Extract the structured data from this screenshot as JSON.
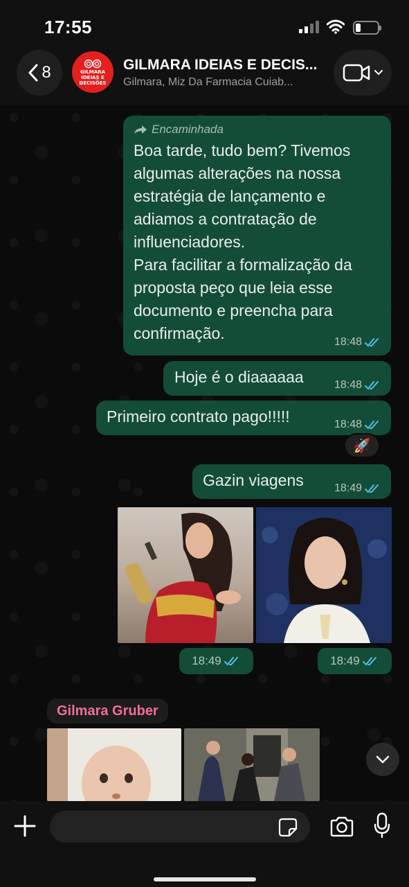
{
  "status_bar": {
    "time": "17:55",
    "battery_percent": 20
  },
  "header": {
    "back_count": "8",
    "title": "GILMARA IDEIAS E DECIS...",
    "subtitle": "Gilmara, Miz Da Farmacia Cuiab...",
    "avatar_text": [
      "GILMARA",
      "IDEIAS E",
      "DECISÕES"
    ],
    "avatar_color": "#e3201e"
  },
  "messages": [
    {
      "forwarded_label": "Encaminhada",
      "text": "Boa tarde, tudo bem? Tivemos algumas alterações na nossa estratégia de lançamento e adiamos a contratação de influenciadores.\nPara facilitar a formalização da proposta peço que leia esse documento e preencha para confirmação.",
      "time": "18:48"
    },
    {
      "text": "Hoje é o diaaaaaa",
      "time": "18:48"
    },
    {
      "text": "Primeiro contrato pago!!!!!",
      "time": "18:48",
      "reaction": "🚀"
    },
    {
      "text": "Gazin viagens",
      "time": "18:49"
    }
  ],
  "photos": [
    {
      "time": "18:49"
    },
    {
      "time": "18:49"
    }
  ],
  "incoming": {
    "sender": "Gilmara Gruber",
    "sender_color": "#f26d98"
  },
  "composer": {
    "placeholder": ""
  },
  "colors": {
    "outgoing_bubble": "#144d37",
    "read_ticks": "#53bdeb",
    "background": "#0b0b0b"
  }
}
